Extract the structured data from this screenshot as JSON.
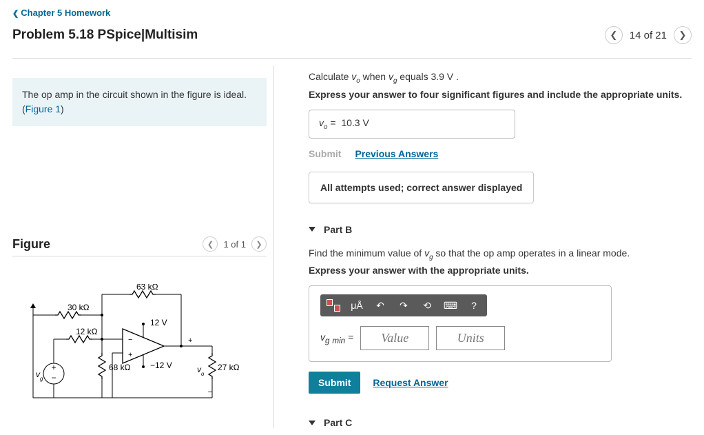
{
  "nav": {
    "back": "Chapter 5 Homework",
    "title": "Problem 5.18 PSpice|Multisim",
    "counter": "14 of 21"
  },
  "prompt": {
    "text": "The op amp in the circuit shown in the figure is ideal. (",
    "figure_link": "Figure 1",
    "close": ")"
  },
  "figure": {
    "label": "Figure",
    "counter": "1 of 1",
    "r1": "30 kΩ",
    "r2": "12 kΩ",
    "r3": "63 kΩ",
    "r4": "68 kΩ",
    "r5": "27 kΩ",
    "vp": "12 V",
    "vn": "−12 V",
    "vg": "v_g",
    "vo": "v_o"
  },
  "partA": {
    "q_pre": "Calculate ",
    "q_mid": " when ",
    "q_post": " equals 3.9 V .",
    "instr": "Express your answer to four significant figures and include the appropriate units.",
    "ans_label": "v_o = ",
    "ans_value": "10.3 V",
    "submit": "Submit",
    "prev": "Previous Answers",
    "feedback": "All attempts used; correct answer displayed"
  },
  "partB": {
    "title": "Part B",
    "q_pre": "Find the minimum value of ",
    "q_post": " so that the op amp operates in a linear mode.",
    "instr": "Express your answer with the appropriate units.",
    "tb_ua": "μÅ",
    "tb_help": "?",
    "eq_label": "v_g min = ",
    "value_ph": "Value",
    "units_ph": "Units",
    "submit": "Submit",
    "request": "Request Answer"
  },
  "partC": {
    "title": "Part C"
  }
}
